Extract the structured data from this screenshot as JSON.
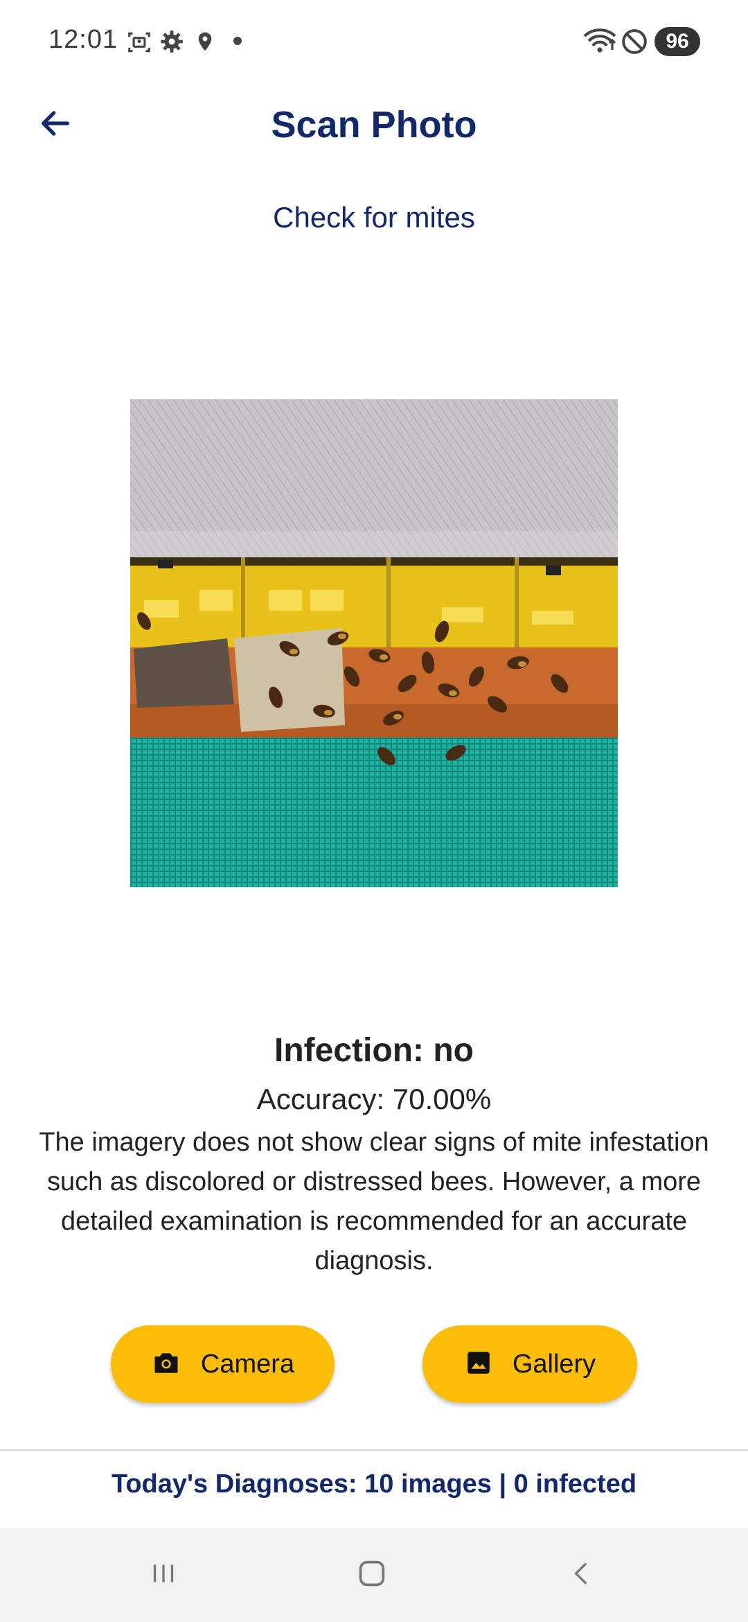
{
  "status_bar": {
    "time": "12:01",
    "battery": "96",
    "icons": [
      "screenshot-icon",
      "settings-icon",
      "location-icon",
      "dot-icon",
      "wifi-icon",
      "do-not-disturb-icon"
    ]
  },
  "app_bar": {
    "title": "Scan Photo",
    "back_icon": "arrow-left-icon"
  },
  "subtitle": "Check for mites",
  "result": {
    "infection": "Infection: no",
    "accuracy": "Accuracy: 70.00%",
    "description": "The imagery does not show clear signs of mite infestation such as discolored or distressed bees. However, a more detailed examination is recommended for an accurate diagnosis."
  },
  "actions": {
    "camera_label": "Camera",
    "camera_icon": "camera-icon",
    "gallery_label": "Gallery",
    "gallery_icon": "image-icon"
  },
  "footer": {
    "stats": "Today's Diagnoses: 10 images | 0 infected"
  },
  "nav_bar": {
    "icons": [
      "recents-icon",
      "home-icon",
      "back-icon"
    ]
  },
  "colors": {
    "primary_navy": "#13286b",
    "button_yellow": "#fbbd07"
  }
}
